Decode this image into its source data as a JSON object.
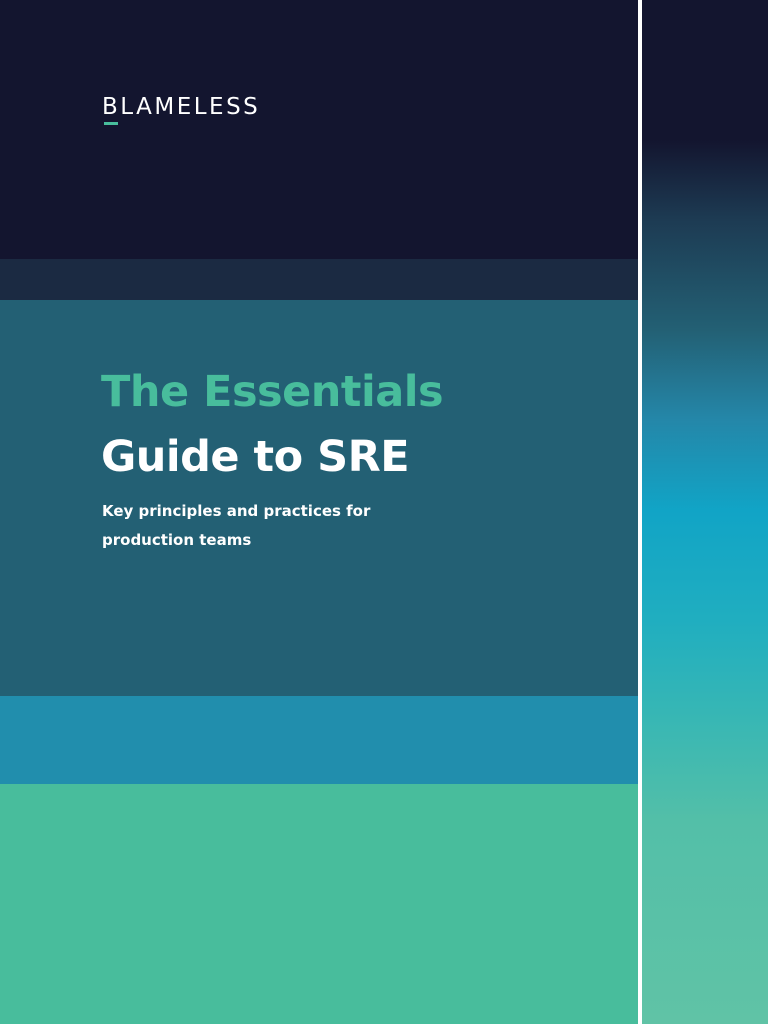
{
  "brand": {
    "name": "BLAMELESS",
    "accent_color": "#48bd9c"
  },
  "cover": {
    "title_line_1": "The Essentials",
    "title_line_2": "Guide to SRE",
    "subtitle_line_1": "Key principles and practices for",
    "subtitle_line_2": "production teams"
  },
  "colors": {
    "navy": "#13152f",
    "dark_slate": "#1b2a42",
    "teal_dark": "#236074",
    "teal_blue": "#218ead",
    "mint": "#48bd9c",
    "title_accent": "#48bd9c",
    "text_white": "#ffffff"
  }
}
